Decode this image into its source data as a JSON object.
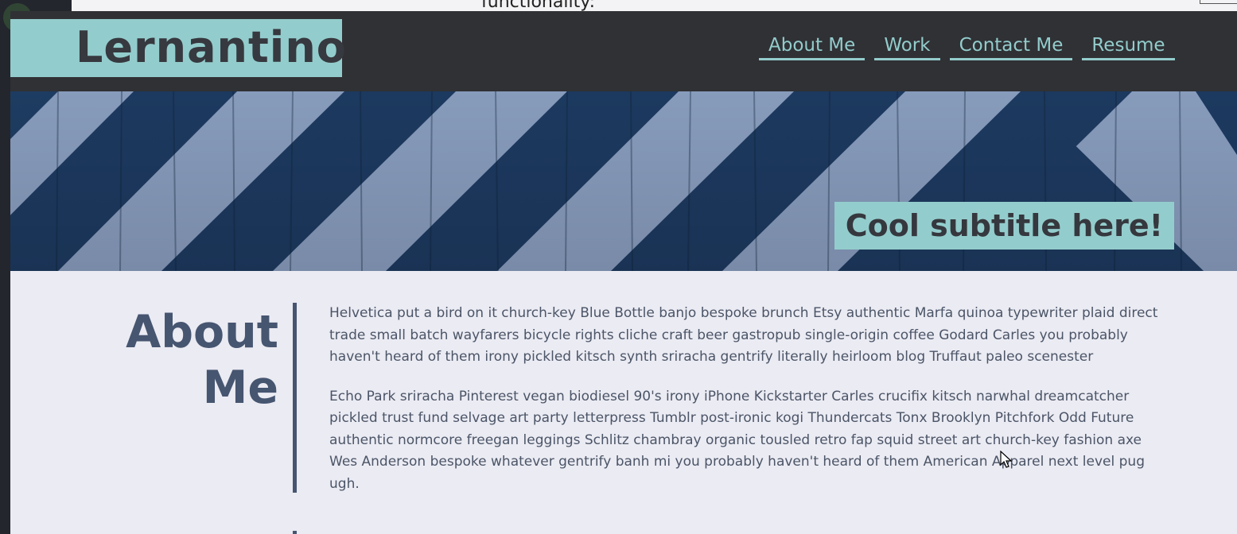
{
  "background_window": {
    "text_fragment": "functionality:"
  },
  "site": {
    "brand": "Lernantino",
    "nav": [
      {
        "label": "About Me"
      },
      {
        "label": "Work"
      },
      {
        "label": "Contact Me"
      },
      {
        "label": "Resume"
      }
    ],
    "hero_subtitle": "Cool subtitle here!"
  },
  "about": {
    "heading_line1": "About",
    "heading_line2": "Me",
    "paragraphs": [
      "Helvetica put a bird on it church-key Blue Bottle banjo bespoke brunch Etsy authentic Marfa quinoa typewriter plaid direct trade small batch wayfarers bicycle rights cliche craft beer gastropub single-origin coffee Godard Carles you probably haven't heard of them irony pickled kitsch synth sriracha gentrify literally heirloom blog Truffaut paleo scenester",
      "Echo Park sriracha Pinterest vegan biodiesel 90's irony iPhone Kickstarter Carles crucifix kitsch narwhal dreamcatcher pickled trust fund selvage art party letterpress Tumblr post-ironic kogi Thundercats Tonx Brooklyn Pitchfork Odd Future authentic normcore freegan leggings Schlitz chambray organic tousled retro fap squid street art church-key fashion axe Wes Anderson bespoke whatever gentrify banh mi you probably haven't heard of them American Apparel next level pug ugh."
    ]
  },
  "colors": {
    "header_bg": "#303135",
    "accent": "#93cccc",
    "heading": "#465570",
    "page_bg": "#ebebf3"
  }
}
